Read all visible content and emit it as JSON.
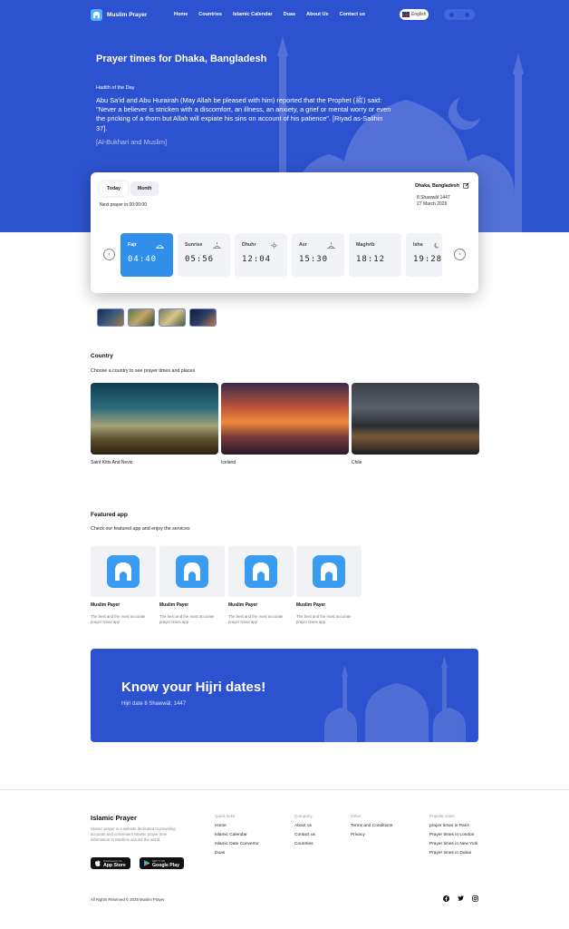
{
  "brand": {
    "name": "Muslim Prayer"
  },
  "nav": {
    "links": [
      "Home",
      "Countries",
      "Islamic Calendar",
      "Duas",
      "About Us",
      "Contact us"
    ],
    "language": "English"
  },
  "hero": {
    "title": "Prayer times for Dhaka, Bangladesh",
    "hadith_label": "Hadith of the Day",
    "hadith_text": "Abu Sa'id and Abu Hurairah (May Allah be pleased with him) reported that the Prophet (ﷺ) said: \"Never a believer is stricken with a discomfort, an illness, an anxiety, a grief or mental worry or even the pricking of a thorn but Allah will expiate his sins on account of his patience\". [Riyad as-Salihin 37].",
    "hadith_source": "[Al-Bukhari and Muslim]"
  },
  "prayer_card": {
    "tabs": [
      "Today",
      "Month"
    ],
    "active_tab": "Today",
    "next_prayer": "Next prayer in 00:00:00",
    "location": "Dhaka, Bangladesh",
    "hijri_date": "8 Shawwāl 1447",
    "gregorian_date": "27 March 2026",
    "prayers": [
      {
        "name": "Fajr",
        "time": "04:40",
        "icon": "sunrise-icon",
        "active": true
      },
      {
        "name": "Sunrise",
        "time": "05:56",
        "icon": "sunrise-icon",
        "active": false
      },
      {
        "name": "Dhuhr",
        "time": "12:04",
        "icon": "sun-icon",
        "active": false
      },
      {
        "name": "Asr",
        "time": "15:30",
        "icon": "sunset-icon",
        "active": false
      },
      {
        "name": "Maghrib",
        "time": "18:12",
        "icon": "sunset-icon",
        "active": false
      },
      {
        "name": "Isha",
        "time": "19:28",
        "icon": "moon-icon",
        "active": false
      }
    ]
  },
  "country_section": {
    "title": "Country",
    "subtitle": "Choose a country to see prayer times and places",
    "countries": [
      "Saint Kitts And Nevis",
      "Iceland",
      "Chile"
    ]
  },
  "featured_section": {
    "title": "Featured app",
    "subtitle": "Check our featured app and enjoy the services",
    "apps": [
      {
        "name": "Muslim Payer",
        "desc": "The best and the most accurate prayer times app"
      },
      {
        "name": "Muslim Payer",
        "desc": "The best and the most accurate prayer times app"
      },
      {
        "name": "Muslim Payer",
        "desc": "The best and the most accurate prayer times app"
      },
      {
        "name": "Muslim Payer",
        "desc": "The best and the most accurate prayer times app"
      }
    ]
  },
  "hijri_banner": {
    "title": "Know your Hijri dates!",
    "subtitle": "Hijri date 8 Shawwāl, 1447"
  },
  "footer": {
    "brand": "Islamic Prayer",
    "description": "Islamic prayer is a website dedicated to providing accurate and convenient Islamic prayer time information to Muslims around the world.",
    "app_store": {
      "small": "Download on the",
      "big": "App Store"
    },
    "google_play": {
      "small": "GET IT ON",
      "big": "Google Play"
    },
    "columns": [
      {
        "title": "Quick links",
        "items": [
          "Home",
          "Islamic Calendar",
          "Islamic Date Convertor",
          "Duas"
        ]
      },
      {
        "title": "Company",
        "items": [
          "About us",
          "Contact us",
          "Countries"
        ]
      },
      {
        "title": "Other",
        "items": [
          "Terms and Conditions",
          "Privacy"
        ]
      },
      {
        "title": "Popular cities",
        "items": [
          "prayer times in Paris",
          "Prayer times in London",
          "Prayer times in New York",
          "Prayer times in Dubai"
        ]
      }
    ],
    "copyright": "All Rights Reserved © 2026 Muslim Prayer"
  },
  "colors": {
    "primary": "#2d52cf",
    "accent": "#2f8fea",
    "app_icon": "#3a9cf0"
  }
}
